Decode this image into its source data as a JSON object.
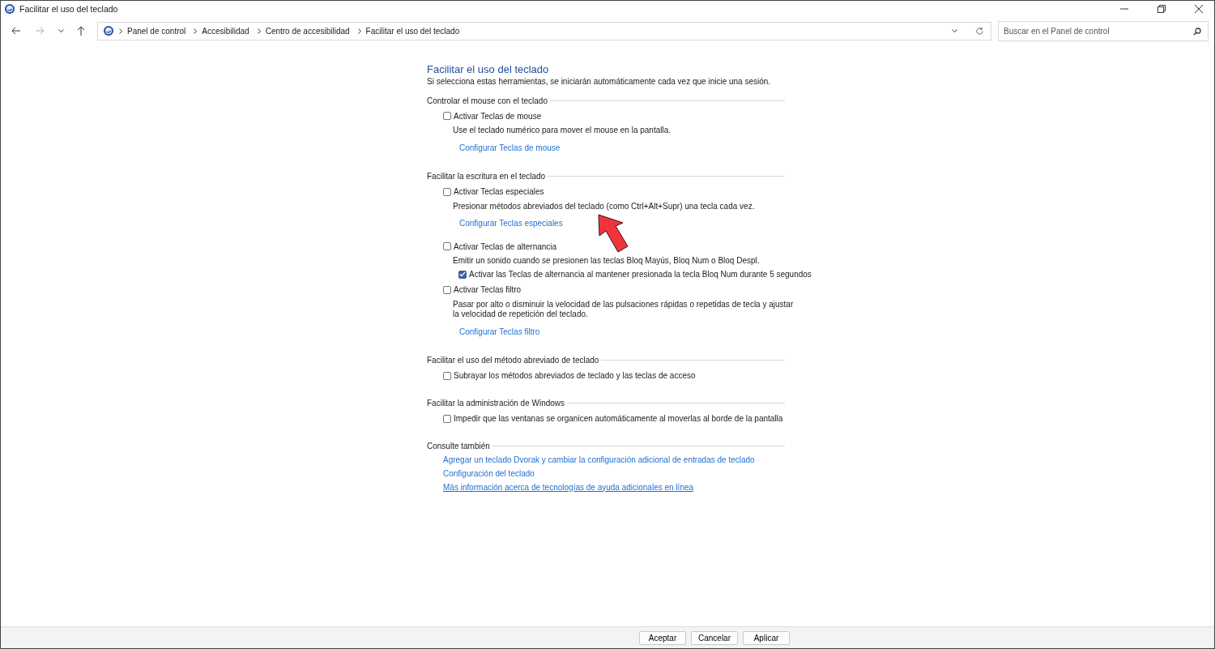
{
  "window": {
    "title": "Facilitar el uso del teclado"
  },
  "address_bar": {
    "breadcrumbs": [
      "Panel de control",
      "Accesibilidad",
      "Centro de accesibilidad",
      "Facilitar el uso del teclado"
    ]
  },
  "search": {
    "placeholder": "Buscar en el Panel de control"
  },
  "page": {
    "title": "Facilitar el uso del teclado",
    "subtitle": "Si selecciona estas herramientas, se iniciarán automáticamente cada vez que inicie una sesión."
  },
  "sections": [
    {
      "heading": "Controlar el mouse con el teclado",
      "items": [
        {
          "kind": "checkbox",
          "label": "Activar Teclas de mouse",
          "checked": false
        },
        {
          "kind": "text",
          "text": "Use el teclado numérico para mover el mouse en la pantalla."
        },
        {
          "kind": "link",
          "text": "Configurar Teclas de mouse",
          "underlined": false
        }
      ]
    },
    {
      "heading": "Facilitar la escritura en el teclado",
      "items": [
        {
          "kind": "checkbox",
          "label": "Activar Teclas especiales",
          "checked": false
        },
        {
          "kind": "text",
          "text": "Presionar métodos abreviados del teclado (como Ctrl+Alt+Supr) una tecla cada vez."
        },
        {
          "kind": "link",
          "text": "Configurar Teclas especiales",
          "underlined": false,
          "annotated": true
        },
        {
          "kind": "checkbox",
          "label": "Activar Teclas de alternancia",
          "checked": false
        },
        {
          "kind": "text",
          "text": "Emitir un sonido cuando se presionen las teclas Bloq Mayús, Bloq Num o Bloq Despl."
        },
        {
          "kind": "subcheckbox",
          "label": "Activar las Teclas de alternancia al mantener presionada la tecla Bloq Num durante 5 segundos",
          "checked": true
        },
        {
          "kind": "checkbox",
          "label": "Activar Teclas filtro",
          "checked": false
        },
        {
          "kind": "text",
          "text": "Pasar por alto o disminuir la velocidad de las pulsaciones rápidas o repetidas de tecla y ajustar la velocidad de repetición del teclado."
        },
        {
          "kind": "link",
          "text": "Configurar Teclas filtro",
          "underlined": false
        }
      ]
    },
    {
      "heading": "Facilitar el uso del método abreviado de teclado",
      "items": [
        {
          "kind": "checkbox",
          "label": "Subrayar los métodos abreviados de teclado y las teclas de acceso",
          "checked": false
        }
      ]
    },
    {
      "heading": "Facilitar la administración de Windows",
      "items": [
        {
          "kind": "checkbox",
          "label": "Impedir que las ventanas se organicen automáticamente al moverlas al borde de la pantalla",
          "checked": false
        }
      ]
    },
    {
      "heading": "Consulte también",
      "items": [
        {
          "kind": "seealso",
          "text": "Agregar un teclado Dvorak y cambiar la configuración adicional de entradas de teclado",
          "underlined": false
        },
        {
          "kind": "seealso",
          "text": "Configuración del teclado",
          "underlined": false
        },
        {
          "kind": "seealso",
          "text": "Más información acerca de tecnologías de ayuda adicionales en línea",
          "underlined": true
        }
      ]
    }
  ],
  "buttons": [
    "Aceptar",
    "Cancelar",
    "Aplicar"
  ]
}
